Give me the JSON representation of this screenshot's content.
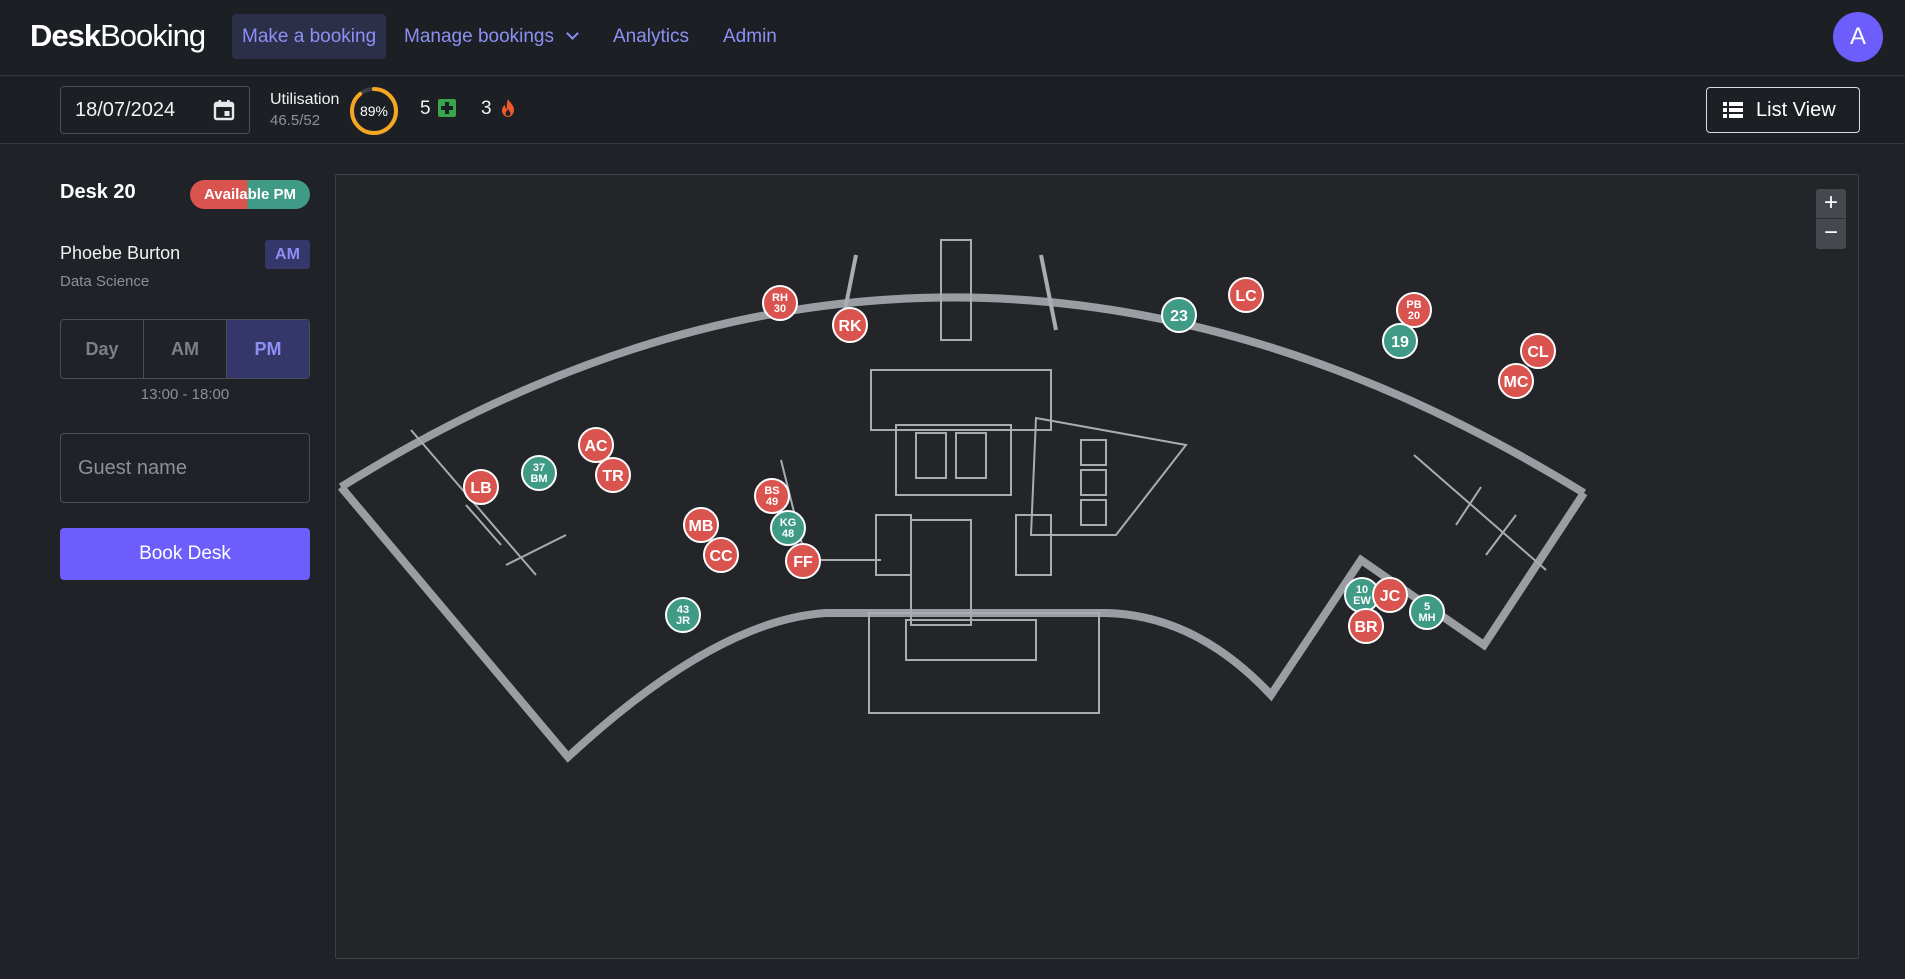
{
  "brand": {
    "bold": "Desk",
    "regular": "Booking"
  },
  "nav": {
    "make_booking": "Make a booking",
    "manage_bookings": "Manage bookings",
    "analytics": "Analytics",
    "admin": "Admin"
  },
  "user": {
    "initial": "A"
  },
  "toolbar": {
    "date": "18/07/2024",
    "utilisation_label": "Utilisation",
    "utilisation_value": "46.5/52",
    "utilisation_percent": "89%",
    "utilisation_fraction": 0.89,
    "first_aid_count": "5",
    "fire_warden_count": "3",
    "list_view_label": "List View"
  },
  "desk_panel": {
    "title": "Desk 20",
    "availability": "Available PM",
    "booker_name": "Phoebe Burton",
    "booker_slot": "AM",
    "booker_team": "Data Science",
    "segments": [
      "Day",
      "AM",
      "PM"
    ],
    "selected_segment": "PM",
    "time_range": "13:00 - 18:00",
    "guest_placeholder": "Guest name",
    "book_button": "Book Desk"
  },
  "map": {
    "zoom_in": "+",
    "zoom_out": "−",
    "markers": [
      {
        "label": "LB",
        "color": "#d9534f"
      },
      {
        "label": "37 BM",
        "color": "#3f9a86"
      },
      {
        "label": "AC",
        "color": "#d9534f"
      },
      {
        "label": "TR",
        "color": "#d9534f"
      },
      {
        "label": "RH 30",
        "color": "#d9534f"
      },
      {
        "label": "RK",
        "color": "#d9534f"
      },
      {
        "label": "23",
        "color": "#3f9a86"
      },
      {
        "label": "LC",
        "color": "#d9534f"
      },
      {
        "label": "PB 20",
        "color": "#d9534f"
      },
      {
        "label": "19",
        "color": "#3f9a86"
      },
      {
        "label": "CL",
        "color": "#d9534f"
      },
      {
        "label": "MC",
        "color": "#d9534f"
      },
      {
        "label": "MB",
        "color": "#d9534f"
      },
      {
        "label": "CC",
        "color": "#d9534f"
      },
      {
        "label": "43 JR",
        "color": "#3f9a86"
      },
      {
        "label": "BS 49",
        "color": "#d9534f"
      },
      {
        "label": "KG 48",
        "color": "#3f9a86"
      },
      {
        "label": "FF",
        "color": "#d9534f"
      },
      {
        "label": "10 EW",
        "color": "#3f9a86"
      },
      {
        "label": "JC",
        "color": "#d9534f"
      },
      {
        "label": "5 MH",
        "color": "#3f9a86"
      },
      {
        "label": "BR",
        "color": "#d9534f"
      }
    ]
  }
}
